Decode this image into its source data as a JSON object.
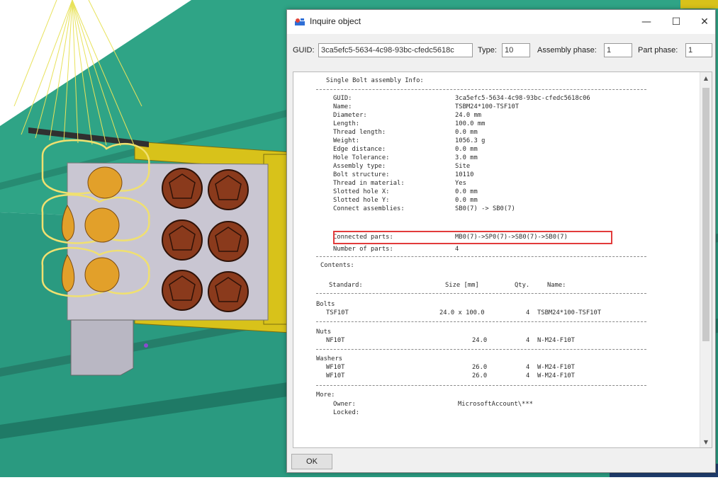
{
  "dialog": {
    "title": "Inquire object",
    "controls": {
      "minimize": "—",
      "maximize": "☐",
      "close": "✕"
    }
  },
  "fields": {
    "guid_label": "GUID:",
    "guid_value": "3ca5efc5-5634-4c98-93bc-cfedc5618c",
    "type_label": "Type:",
    "type_value": "10",
    "assembly_phase_label": "Assembly phase:",
    "assembly_phase_value": "1",
    "part_phase_label": "Part phase:",
    "part_phase_value": "1"
  },
  "report": {
    "header": "Single Bolt assembly Info:",
    "properties": [
      {
        "label": "GUID:",
        "value": "3ca5efc5-5634-4c98-93bc-cfedc5618c06"
      },
      {
        "label": "Name:",
        "value": "TSBM24*100-TSF10T"
      },
      {
        "label": "Diameter:",
        "value": "24.0 mm"
      },
      {
        "label": "Length:",
        "value": "100.0 mm"
      },
      {
        "label": "Thread length:",
        "value": "0.0 mm"
      },
      {
        "label": "Weight:",
        "value": "1056.3 g"
      },
      {
        "label": "Edge distance:",
        "value": "0.0 mm"
      },
      {
        "label": "Hole Tolerance:",
        "value": "3.0 mm"
      },
      {
        "label": "Assembly type:",
        "value": "Site"
      },
      {
        "label": "Bolt structure:",
        "value": "10110"
      },
      {
        "label": "Thread in material:",
        "value": "Yes"
      },
      {
        "label": "Slotted hole X:",
        "value": "0.0 mm"
      },
      {
        "label": "Slotted hole Y:",
        "value": "0.0 mm"
      },
      {
        "label": "Connect assemblies:",
        "value": "SB0(7) -> SB0(7)"
      },
      {
        "label": "Connected parts:",
        "value": "MB0(7)->SP0(7)->SB0(7)->SB0(7)"
      },
      {
        "label": "Number of parts:",
        "value": "4"
      }
    ],
    "contents_label": "Contents:",
    "table_header": {
      "standard": "Standard:",
      "size": "Size [mm]",
      "qty": "Qty.",
      "name": "Name:"
    },
    "sections": [
      {
        "title": "Bolts",
        "rows": [
          {
            "standard": "TSF10T",
            "size": "24.0 x 100.0",
            "qty": "4",
            "name": "TSBM24*100-TSF10T"
          }
        ]
      },
      {
        "title": "Nuts",
        "rows": [
          {
            "standard": "NF10T",
            "size": "24.0",
            "qty": "4",
            "name": "N-M24-F10T"
          }
        ]
      },
      {
        "title": "Washers",
        "rows": [
          {
            "standard": "WF10T",
            "size": "26.0",
            "qty": "4",
            "name": "W-M24-F10T"
          },
          {
            "standard": "WF10T",
            "size": "26.0",
            "qty": "4",
            "name": "W-M24-F10T"
          }
        ]
      }
    ],
    "more": {
      "label": "More:",
      "owner_label": "Owner:",
      "owner_value": "MicrosoftAccount\\***",
      "locked_label": "Locked:"
    }
  },
  "buttons": {
    "ok": "OK"
  },
  "colors": {
    "beam_green": "#2fa486",
    "beam_dark": "#1a5e4e",
    "plate_yellow": "#d8c21a",
    "bolt_brown": "#8a3a1c",
    "highlight": "#f0e070",
    "selection_box": "#e23b3b"
  }
}
